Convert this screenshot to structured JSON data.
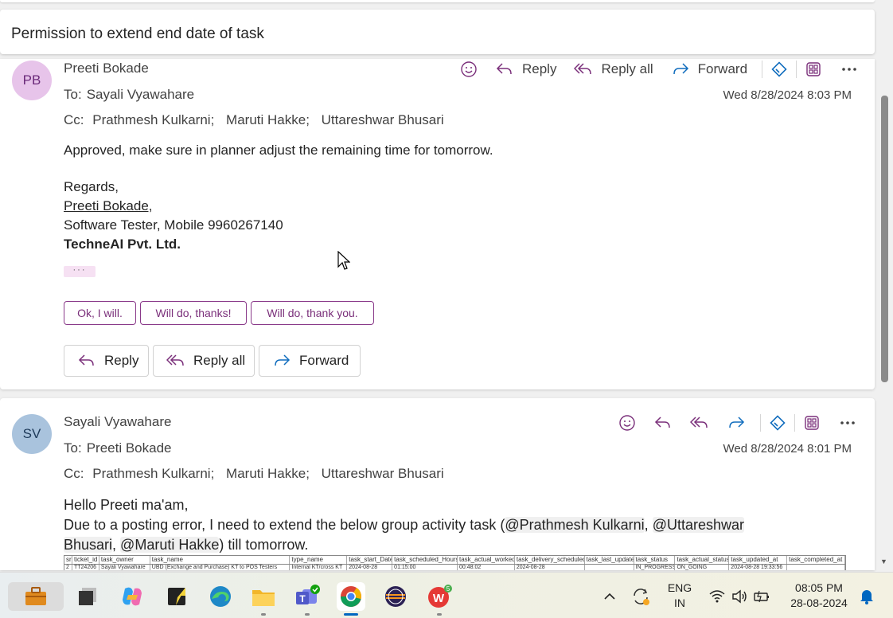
{
  "subject": "Permission to extend end date of task",
  "message1": {
    "initials": "PB",
    "sender": "Preeti Bokade",
    "to_label": "To:",
    "to": "Sayali Vyawahare",
    "cc_label": "Cc:",
    "cc": [
      "Prathmesh Kulkarni;",
      "Maruti Hakke;",
      "Uttareshwar Bhusari"
    ],
    "date": "Wed 8/28/2024 8:03 PM",
    "actions": {
      "reply": "Reply",
      "reply_all": "Reply all",
      "forward": "Forward"
    },
    "body": "Approved, make sure in planner adjust the remaining time for tomorrow.",
    "regards": "Regards,",
    "sig_name": "Preeti Bokade,",
    "sig_title": "Software Tester, Mobile 9960267140",
    "sig_company": "TechneAI Pvt. Ltd.",
    "more": "···",
    "suggestions": [
      "Ok, I will.",
      "Will do, thanks!",
      "Will do, thank you."
    ],
    "buttons": {
      "reply": "Reply",
      "reply_all": "Reply all",
      "forward": "Forward"
    }
  },
  "message2": {
    "initials": "SV",
    "sender": "Sayali Vyawahare",
    "to_label": "To:",
    "to": "Preeti Bokade",
    "cc_label": "Cc:",
    "cc": [
      "Prathmesh Kulkarni;",
      "Maruti Hakke;",
      "Uttareshwar Bhusari"
    ],
    "date": "Wed 8/28/2024 8:01 PM",
    "greeting": "Hello Preeti ma'am,",
    "body_1": "Due to a posting error, I need to extend the below group activity task (",
    "mention_1": "@Prathmesh Kulkarni",
    "sep_1": ", ",
    "mention_2a": "@Uttareshwar",
    "mention_2b": "Bhusari",
    "sep_2": ", ",
    "mention_3": "@Maruti Hakke",
    "body_2": ") till tomorrow.",
    "table": {
      "headers": [
        "sr",
        "ticket_id",
        "task_owner",
        "task_name",
        "type_name",
        "task_start_Date",
        "task_scheduled_Hours",
        "task_actual_worked",
        "task_delivery_scheduled",
        "task_last_update",
        "task_status",
        "task_actual_status",
        "task_updated_at",
        "task_completed_at"
      ],
      "row": [
        "2",
        "TT24206",
        "Sayali Vyawahare",
        "UBD (Exchange and Purchase) KT to POS Testers",
        "Internal KT/cross KT",
        "2024-08-28",
        "01:15:00",
        "00:48:02",
        "2024-08-28",
        "",
        "IN_PROGRESS",
        "ON_GOING",
        "2024-08-28 19:33:56",
        ""
      ]
    }
  },
  "taskbar": {
    "lang_1": "ENG",
    "lang_2": "IN",
    "time": "08:05 PM",
    "date": "28-08-2024",
    "wps_badge": "5"
  },
  "colors": {
    "accent": "#0f6cbd",
    "chip": "#7a2f7a",
    "pb_avatar": "#e7c4ea",
    "sv_avatar": "#a9c3dd"
  }
}
